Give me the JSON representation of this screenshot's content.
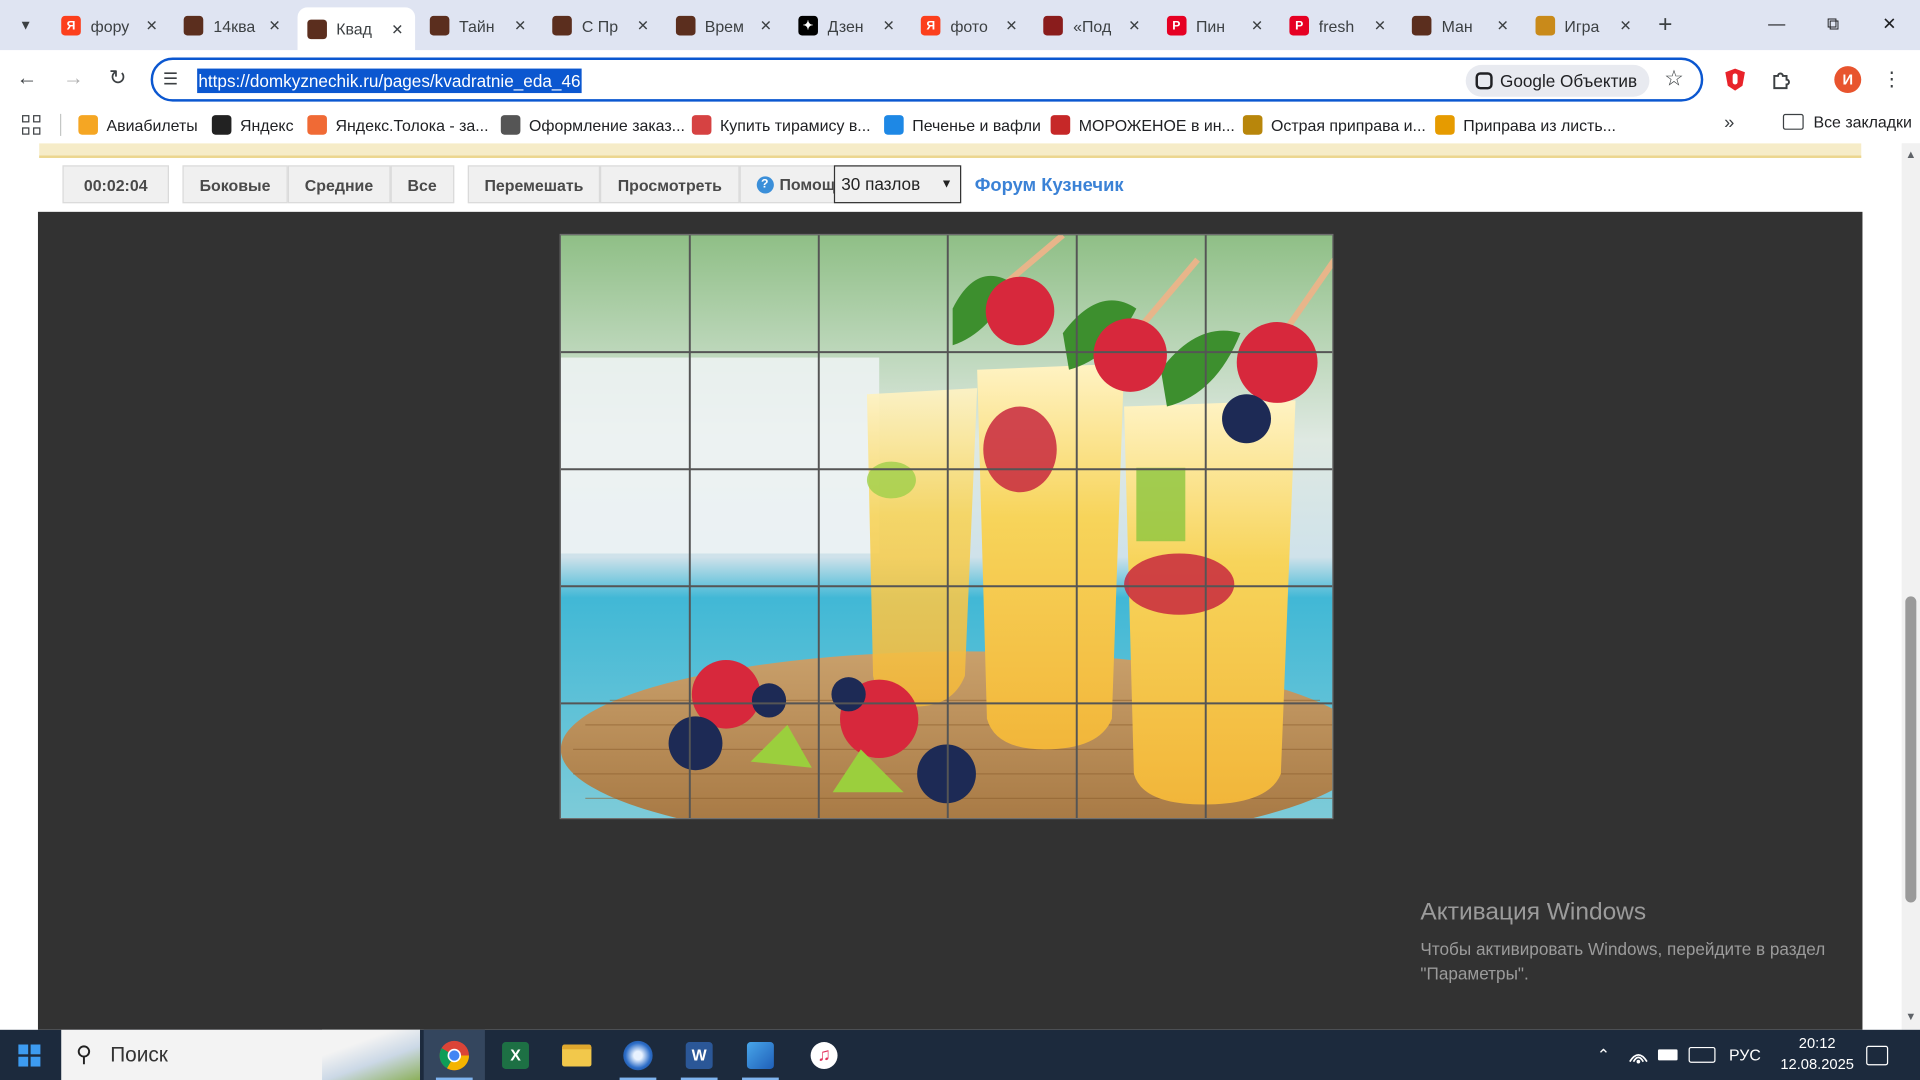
{
  "browser": {
    "tabs": [
      {
        "title": "фору",
        "favicon": "yandex",
        "color": "#fc3f1d",
        "letter": "Я"
      },
      {
        "title": "14ква",
        "favicon": "kuznechik",
        "color": "#5b2e1e",
        "letter": ""
      },
      {
        "title": "Квад",
        "favicon": "kuznechik",
        "color": "#5b2e1e",
        "letter": ""
      },
      {
        "title": "Тайн",
        "favicon": "kuznechik",
        "color": "#5b2e1e",
        "letter": ""
      },
      {
        "title": "С Пр",
        "favicon": "kuznechik",
        "color": "#5b2e1e",
        "letter": ""
      },
      {
        "title": "Врем",
        "favicon": "kuznechik",
        "color": "#5b2e1e",
        "letter": ""
      },
      {
        "title": "Дзен",
        "favicon": "dzen",
        "color": "#000000",
        "letter": "✦"
      },
      {
        "title": "фото",
        "favicon": "yandex",
        "color": "#fc3f1d",
        "letter": "Я"
      },
      {
        "title": "«Под",
        "favicon": "fire",
        "color": "#8a1c1c",
        "letter": ""
      },
      {
        "title": "Пин",
        "favicon": "pinterest",
        "color": "#e60023",
        "letter": "P"
      },
      {
        "title": "fresh",
        "favicon": "pinterest",
        "color": "#e60023",
        "letter": "P"
      },
      {
        "title": "Ман",
        "favicon": "kuznechik",
        "color": "#5b2e1e",
        "letter": ""
      },
      {
        "title": "Игра",
        "favicon": "owl",
        "color": "#c98a1a",
        "letter": ""
      }
    ],
    "active_tab_index": 2,
    "url": "https://domkyznechik.ru/pages/kvadratnie_eda_46",
    "lens_label": "Google Объектив",
    "avatar_letter": "И",
    "bookmarks": [
      {
        "label": "Авиабилеты",
        "color": "#f5a623"
      },
      {
        "label": "Яндекс",
        "color": "#222222"
      },
      {
        "label": "Яндекс.Толока - за...",
        "color": "#f06a35"
      },
      {
        "label": "Оформление заказ...",
        "color": "#555555"
      },
      {
        "label": "Купить тирамису в...",
        "color": "#d64242"
      },
      {
        "label": "Печенье и вафли",
        "color": "#1e88e5"
      },
      {
        "label": "МОРОЖЕНОЕ в ин...",
        "color": "#c62828"
      },
      {
        "label": "Острая приправа и...",
        "color": "#b8860b"
      },
      {
        "label": "Приправа из листь...",
        "color": "#e69b00"
      }
    ],
    "all_bookmarks_label": "Все закладки"
  },
  "game": {
    "timer": "00:02:04",
    "buttons_group1": [
      "Боковые",
      "Средние",
      "Все"
    ],
    "buttons_group2": [
      "Перемешать",
      "Просмотреть",
      "Помощь"
    ],
    "pieces_select": "30 пазлов",
    "forum_link": "Форум Кузнечик",
    "grid": {
      "columns": 6,
      "rows": 5
    }
  },
  "watermark": {
    "title": "Активация Windows",
    "text": "Чтобы активировать Windows, перейдите в раздел \"Параметры\"."
  },
  "taskbar": {
    "search_placeholder": "Поиск",
    "language": "РУС",
    "time": "20:12",
    "date": "12.08.2025"
  }
}
